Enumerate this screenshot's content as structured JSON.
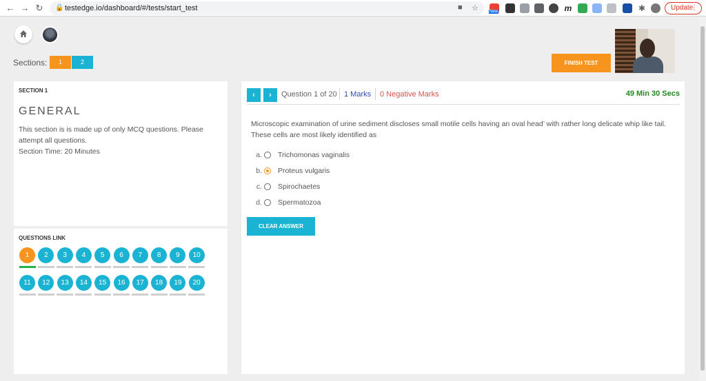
{
  "browser": {
    "url": "testedge.io/dashboard/#/tests/start_test",
    "update_label": "Update",
    "ext_new_badge": "New"
  },
  "header": {
    "sections_label": "Sections:",
    "section_buttons": [
      "1",
      "2"
    ],
    "finish_label": "FINISH TEST"
  },
  "section_panel": {
    "title": "SECTION 1",
    "name": "GENERAL",
    "description": "This section is is made up of only MCQ questions. Please attempt all questions.",
    "time": "Section Time: 20 Minutes"
  },
  "questions_panel": {
    "title": "QUESTIONS LINK",
    "numbers": [
      "1",
      "2",
      "3",
      "4",
      "5",
      "6",
      "7",
      "8",
      "9",
      "10",
      "11",
      "12",
      "13",
      "14",
      "15",
      "16",
      "17",
      "18",
      "19",
      "20"
    ],
    "current": 1
  },
  "question": {
    "counter": "Question 1 of 20",
    "marks": "1 Marks",
    "negative": "0 Negative Marks",
    "timer": "49 Min 30 Secs",
    "text": "Microscopic examination of urine sediment discloses small motile cells having an oval head’ with rather long delicate whip like tail. These cells are most likely identified as",
    "options": [
      {
        "letter": "a.",
        "text": "Trichomonas vaginalis",
        "selected": false
      },
      {
        "letter": "b.",
        "text": "Proteus vulgaris",
        "selected": true
      },
      {
        "letter": "c.",
        "text": "Spirochaetes",
        "selected": false
      },
      {
        "letter": "d.",
        "text": "Spermatozoa",
        "selected": false
      }
    ],
    "clear_label": "CLEAR ANSWER"
  },
  "colors": {
    "accent": "#1ab3d4",
    "orange": "#f7941d",
    "marks_blue": "#2e4bb5",
    "negative_red": "#d9534f",
    "timer_green": "#1e8a1e"
  }
}
